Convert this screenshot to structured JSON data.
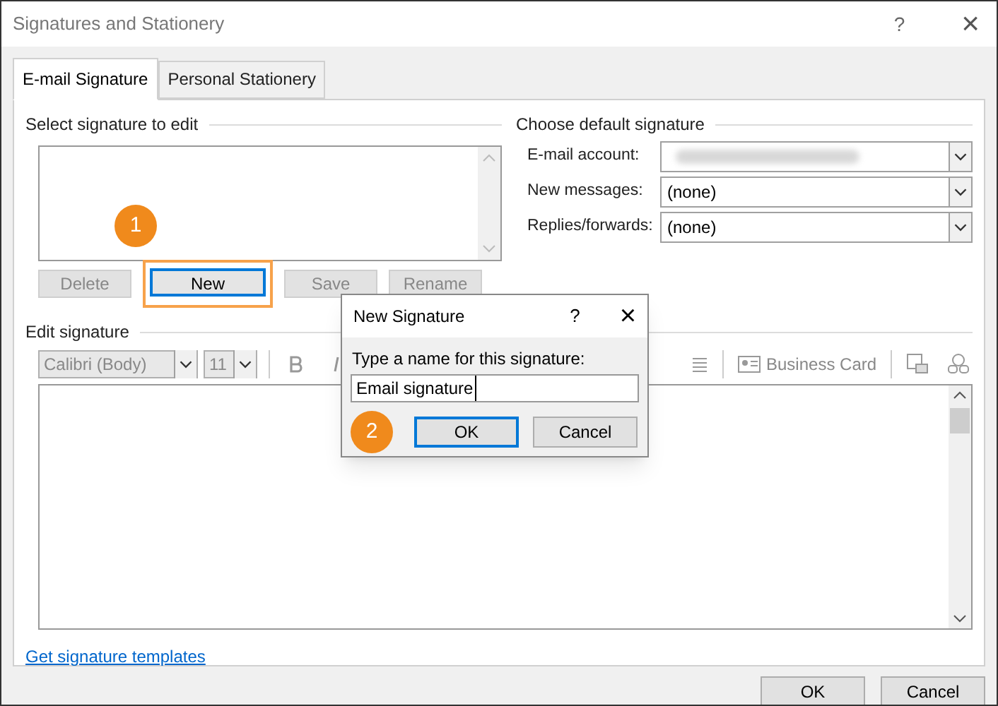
{
  "window": {
    "title": "Signatures and Stationery",
    "help": "?",
    "close": "×"
  },
  "tabs": [
    {
      "label": "E-mail Signature",
      "selected": true
    },
    {
      "label": "Personal Stationery",
      "selected": false
    }
  ],
  "select_section": {
    "heading": "Select signature to edit",
    "buttons": [
      {
        "label": "Delete",
        "disabled": true,
        "highlighted": false
      },
      {
        "label": "New",
        "disabled": false,
        "highlighted": true
      },
      {
        "label": "Save",
        "disabled": true,
        "highlighted": false
      },
      {
        "label": "Rename",
        "disabled": true,
        "highlighted": false
      }
    ],
    "callout": "1"
  },
  "default_section": {
    "heading": "Choose default signature",
    "fields": [
      {
        "label": "E-mail account:",
        "blurred": true
      },
      {
        "label": "New messages:",
        "value": "(none)",
        "blurred": false
      },
      {
        "label": "Replies/forwards:",
        "value": "(none)",
        "blurred": false
      }
    ]
  },
  "edit_section": {
    "heading": "Edit signature",
    "font": "Calibri (Body)",
    "size": "11",
    "business_card": "Business Card"
  },
  "link": "Get signature templates",
  "footer_buttons": [
    "OK",
    "Cancel"
  ],
  "modal": {
    "title": "New Signature",
    "help": "?",
    "close": "×",
    "prompt": "Type a name for this signature:",
    "value": "Email signature",
    "buttons": [
      {
        "label": "OK",
        "default": true
      },
      {
        "label": "Cancel",
        "default": false
      }
    ],
    "callout": "2"
  }
}
